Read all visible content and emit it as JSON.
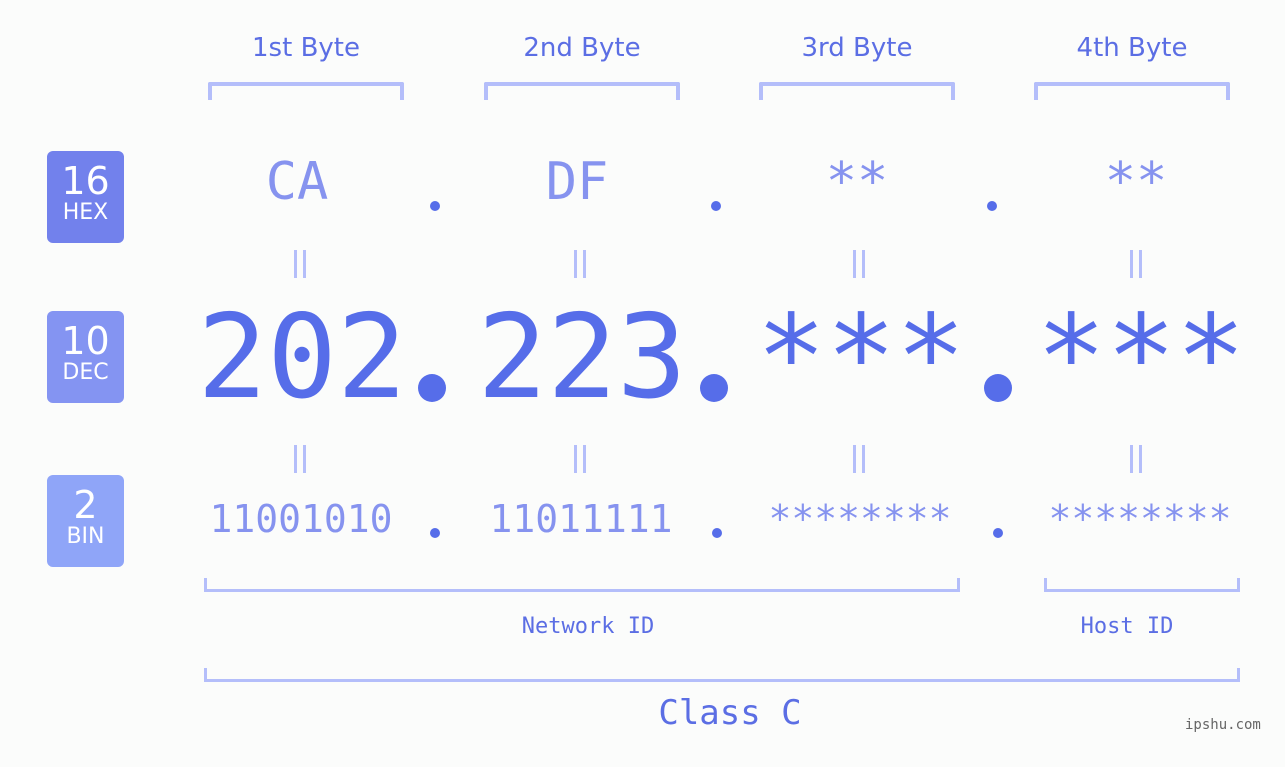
{
  "header": {
    "bytes": [
      "1st Byte",
      "2nd Byte",
      "3rd Byte",
      "4th Byte"
    ]
  },
  "badges": {
    "hex": {
      "num": "16",
      "name": "HEX",
      "color": "#7281ec"
    },
    "dec": {
      "num": "10",
      "name": "DEC",
      "color": "#8494f2"
    },
    "bin": {
      "num": "2",
      "name": "BIN",
      "color": "#8fa5f8"
    }
  },
  "hex": [
    "CA",
    "DF",
    "**",
    "**"
  ],
  "dec": [
    "202",
    "223",
    "***",
    "***"
  ],
  "bin": [
    "11001010",
    "11011111",
    "********",
    "********"
  ],
  "labels": {
    "network_id": "Network ID",
    "host_id": "Host ID",
    "class": "Class C"
  },
  "watermark": "ipshu.com",
  "colors": {
    "accent": "#566de9",
    "light": "#8693ef",
    "bracket": "#b4befa"
  }
}
